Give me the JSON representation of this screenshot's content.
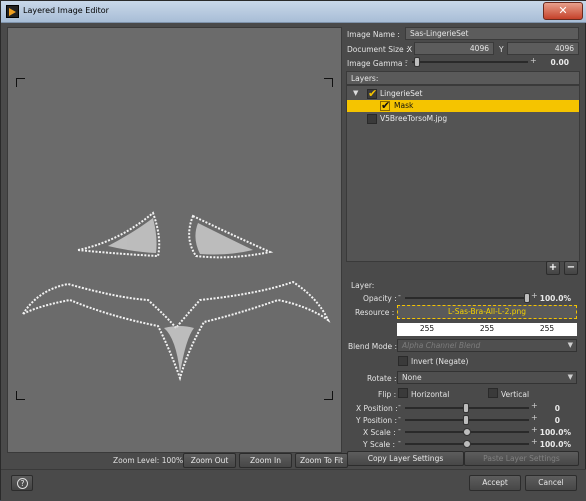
{
  "window": {
    "title": "Layered Image Editor",
    "close": "✕"
  },
  "canvas": {
    "zoom_label": "Zoom Level: 100%",
    "zoom_out": "Zoom Out",
    "zoom_in": "Zoom In",
    "zoom_fit": "Zoom To Fit"
  },
  "image": {
    "name_label": "Image Name :",
    "name": "Sas-LingerieSet",
    "size_label": "Document Size :",
    "x_label": "X",
    "y_label": "Y",
    "width": "4096",
    "height": "4096",
    "gamma_label": "Image Gamma :",
    "gamma_value": "0.00"
  },
  "layers": {
    "header": "Layers:",
    "items": [
      {
        "label": "LingerieSet",
        "checked": true,
        "group": true
      },
      {
        "label": "Mask",
        "checked": true,
        "selected": true
      },
      {
        "label": "V5BreeTorsoM.jpg",
        "checked": false
      }
    ],
    "add": "+",
    "remove": "−"
  },
  "layer": {
    "header": "Layer:",
    "opacity_label": "Opacity :",
    "opacity_value": "100.0%",
    "opacity_level": 1.0,
    "resource_label": "Resource :",
    "resource": "L-Sas-Bra-All-L-2.png",
    "color": [
      "255",
      "255",
      "255"
    ],
    "blend_label": "Blend Mode :",
    "blend": "Alpha Channel Blend",
    "invert": "Invert (Negate)",
    "rotate_label": "Rotate :",
    "rotate": "None",
    "flip_label": "Flip :",
    "horizontal": "Horizontal",
    "vertical": "Vertical",
    "xpos_label": "X Position :",
    "xpos": "0",
    "ypos_label": "Y Position :",
    "ypos": "0",
    "xscale_label": "X Scale :",
    "xscale": "100.0%",
    "yscale_label": "Y Scale :",
    "yscale": "100.0%",
    "copy": "Copy Layer Settings",
    "paste": "Paste Layer Settings"
  },
  "footer": {
    "help": "?",
    "accept": "Accept",
    "cancel": "Cancel"
  }
}
